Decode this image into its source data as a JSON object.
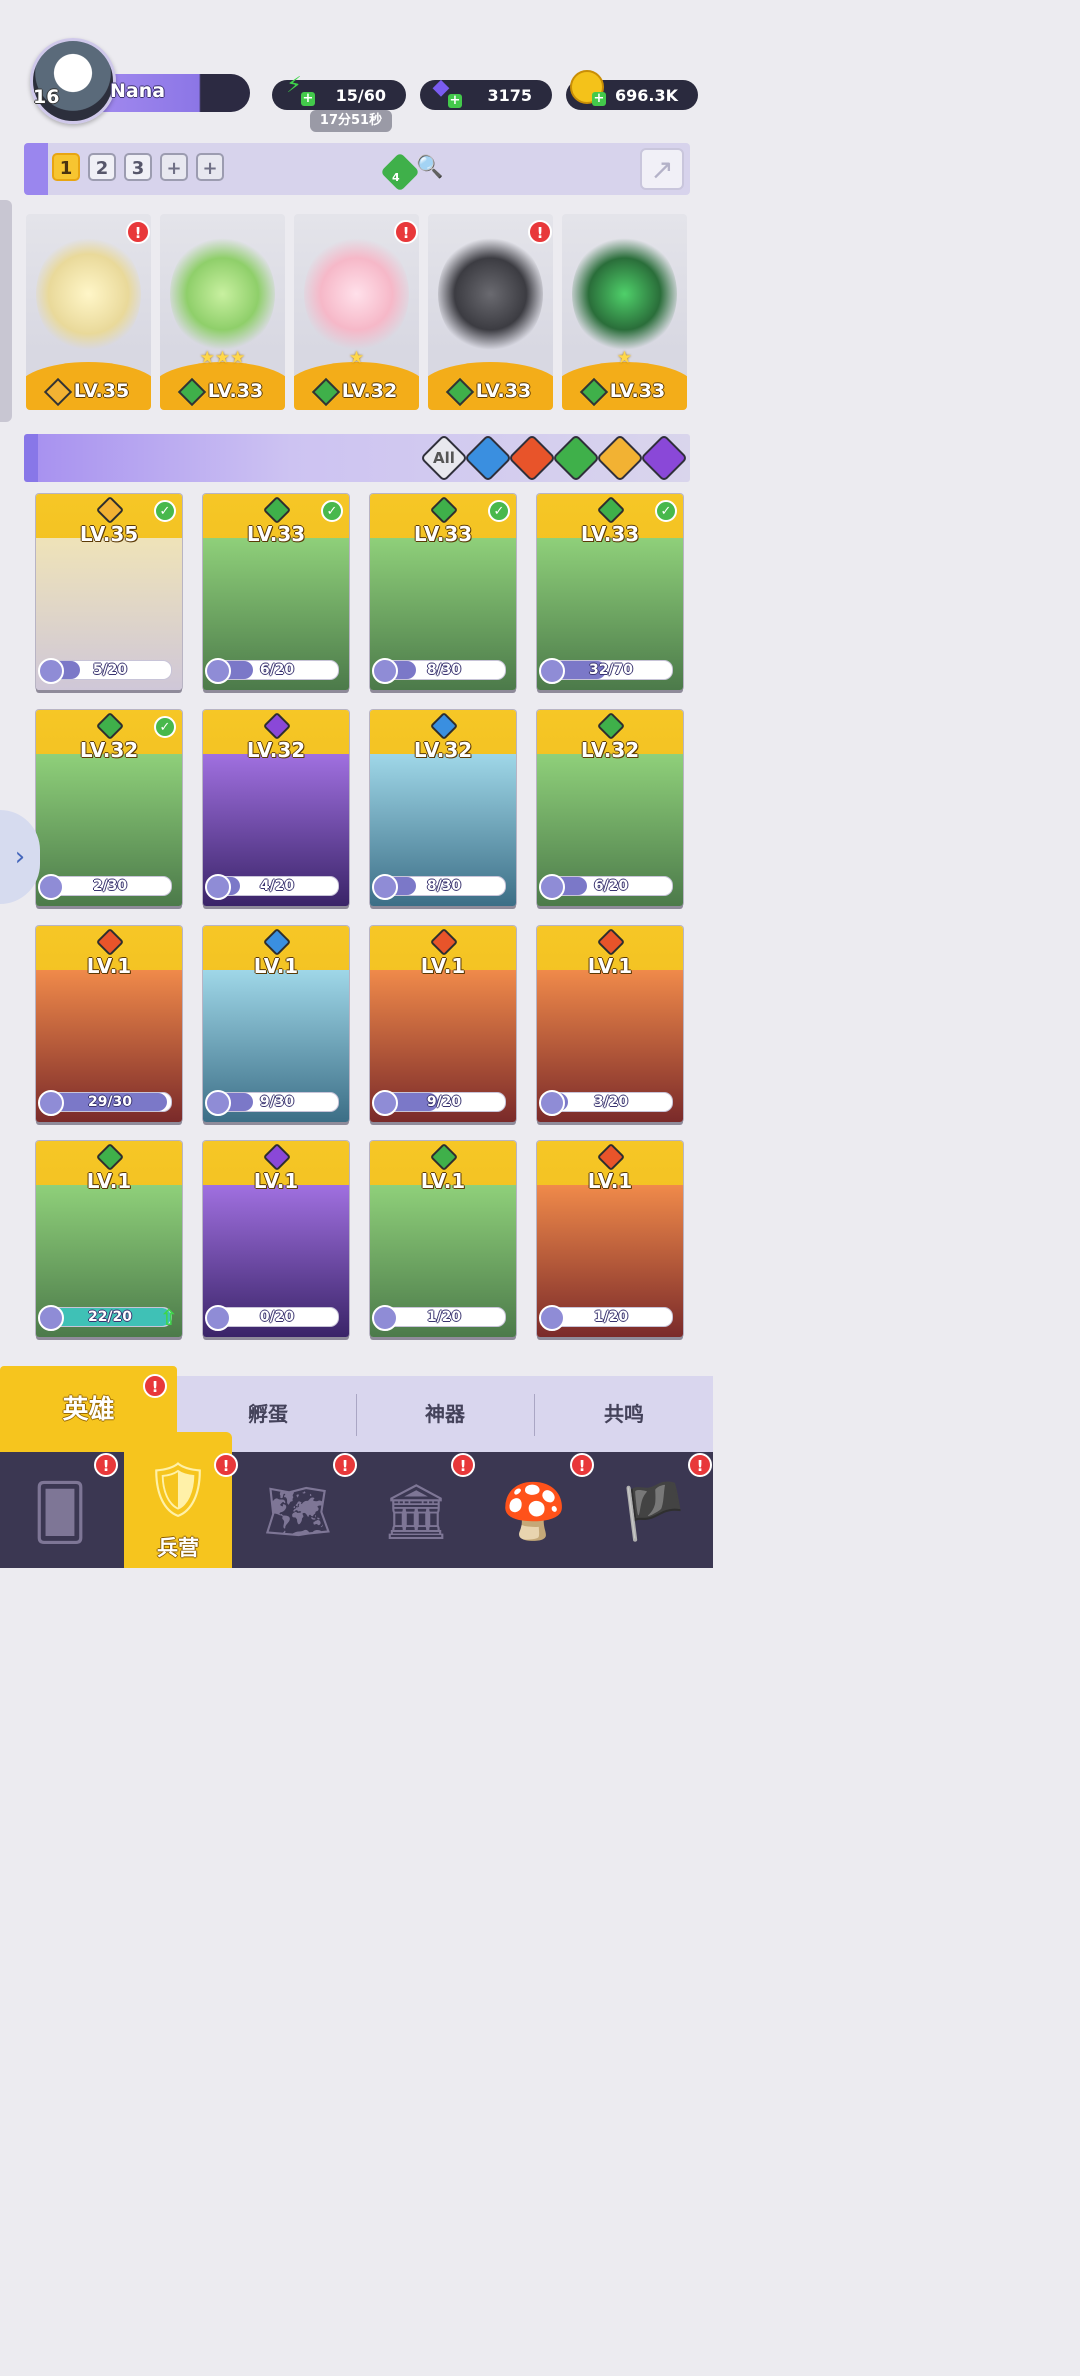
{
  "player": {
    "name": "Nana",
    "level": "16"
  },
  "resources": {
    "energy": "15/60",
    "energy_timer": "17分51秒",
    "gems": "3175",
    "gold": "696.3K"
  },
  "team": {
    "tabs": [
      "1",
      "2",
      "3",
      "+",
      "+"
    ],
    "active_tab": 0,
    "gem_count": "4",
    "slots": [
      {
        "level": "LV.35",
        "stars": "",
        "element": "light",
        "alert": "!"
      },
      {
        "level": "LV.33",
        "stars": "★★★",
        "element": "nature",
        "alert": ""
      },
      {
        "level": "LV.32",
        "stars": "★",
        "element": "nature",
        "alert": "!"
      },
      {
        "level": "LV.33",
        "stars": "",
        "element": "nature",
        "alert": "!"
      },
      {
        "level": "LV.33",
        "stars": "★",
        "element": "nature",
        "alert": ""
      }
    ]
  },
  "filters": {
    "items": [
      "All",
      "water-icon",
      "fire-icon",
      "nature-icon",
      "light-icon",
      "dark-icon"
    ],
    "all_label": "All"
  },
  "colors": {
    "light": "#f2b233",
    "nature": "#3fb04a",
    "water": "#3a8fe0",
    "fire": "#e8542a",
    "dark": "#8a48d8"
  },
  "heroes": [
    {
      "level": "LV.35",
      "element": "light",
      "progress": "5/20",
      "fraction": 0.25,
      "checked": true
    },
    {
      "level": "LV.33",
      "element": "nature",
      "progress": "6/20",
      "fraction": 0.3,
      "checked": true
    },
    {
      "level": "LV.33",
      "element": "nature",
      "progress": "8/30",
      "fraction": 0.27,
      "checked": true
    },
    {
      "level": "LV.33",
      "element": "nature",
      "progress": "32/70",
      "fraction": 0.46,
      "checked": true
    },
    {
      "level": "LV.32",
      "element": "nature",
      "progress": "2/30",
      "fraction": 0.07,
      "checked": true
    },
    {
      "level": "LV.32",
      "element": "dark",
      "progress": "4/20",
      "fraction": 0.2,
      "checked": false
    },
    {
      "level": "LV.32",
      "element": "water",
      "progress": "8/30",
      "fraction": 0.27,
      "checked": false
    },
    {
      "level": "LV.32",
      "element": "nature",
      "progress": "6/20",
      "fraction": 0.3,
      "checked": false
    },
    {
      "level": "LV.1",
      "element": "fire",
      "progress": "29/30",
      "fraction": 0.97,
      "checked": false
    },
    {
      "level": "LV.1",
      "element": "water",
      "progress": "9/30",
      "fraction": 0.3,
      "checked": false
    },
    {
      "level": "LV.1",
      "element": "fire",
      "progress": "9/20",
      "fraction": 0.45,
      "checked": false
    },
    {
      "level": "LV.1",
      "element": "fire",
      "progress": "3/20",
      "fraction": 0.15,
      "checked": false
    },
    {
      "level": "LV.1",
      "element": "nature",
      "progress": "22/20",
      "fraction": 1.0,
      "checked": false,
      "upgrade": true
    },
    {
      "level": "LV.1",
      "element": "dark",
      "progress": "0/20",
      "fraction": 0.0,
      "checked": false
    },
    {
      "level": "LV.1",
      "element": "nature",
      "progress": "1/20",
      "fraction": 0.05,
      "checked": false
    },
    {
      "level": "LV.1",
      "element": "fire",
      "progress": "1/20",
      "fraction": 0.05,
      "checked": false
    }
  ],
  "subtabs": {
    "heroes": "英雄",
    "hatch": "孵蛋",
    "artifacts": "神器",
    "resonance": "共鸣"
  },
  "nav": {
    "barracks_label": "兵营",
    "alert": "!"
  }
}
